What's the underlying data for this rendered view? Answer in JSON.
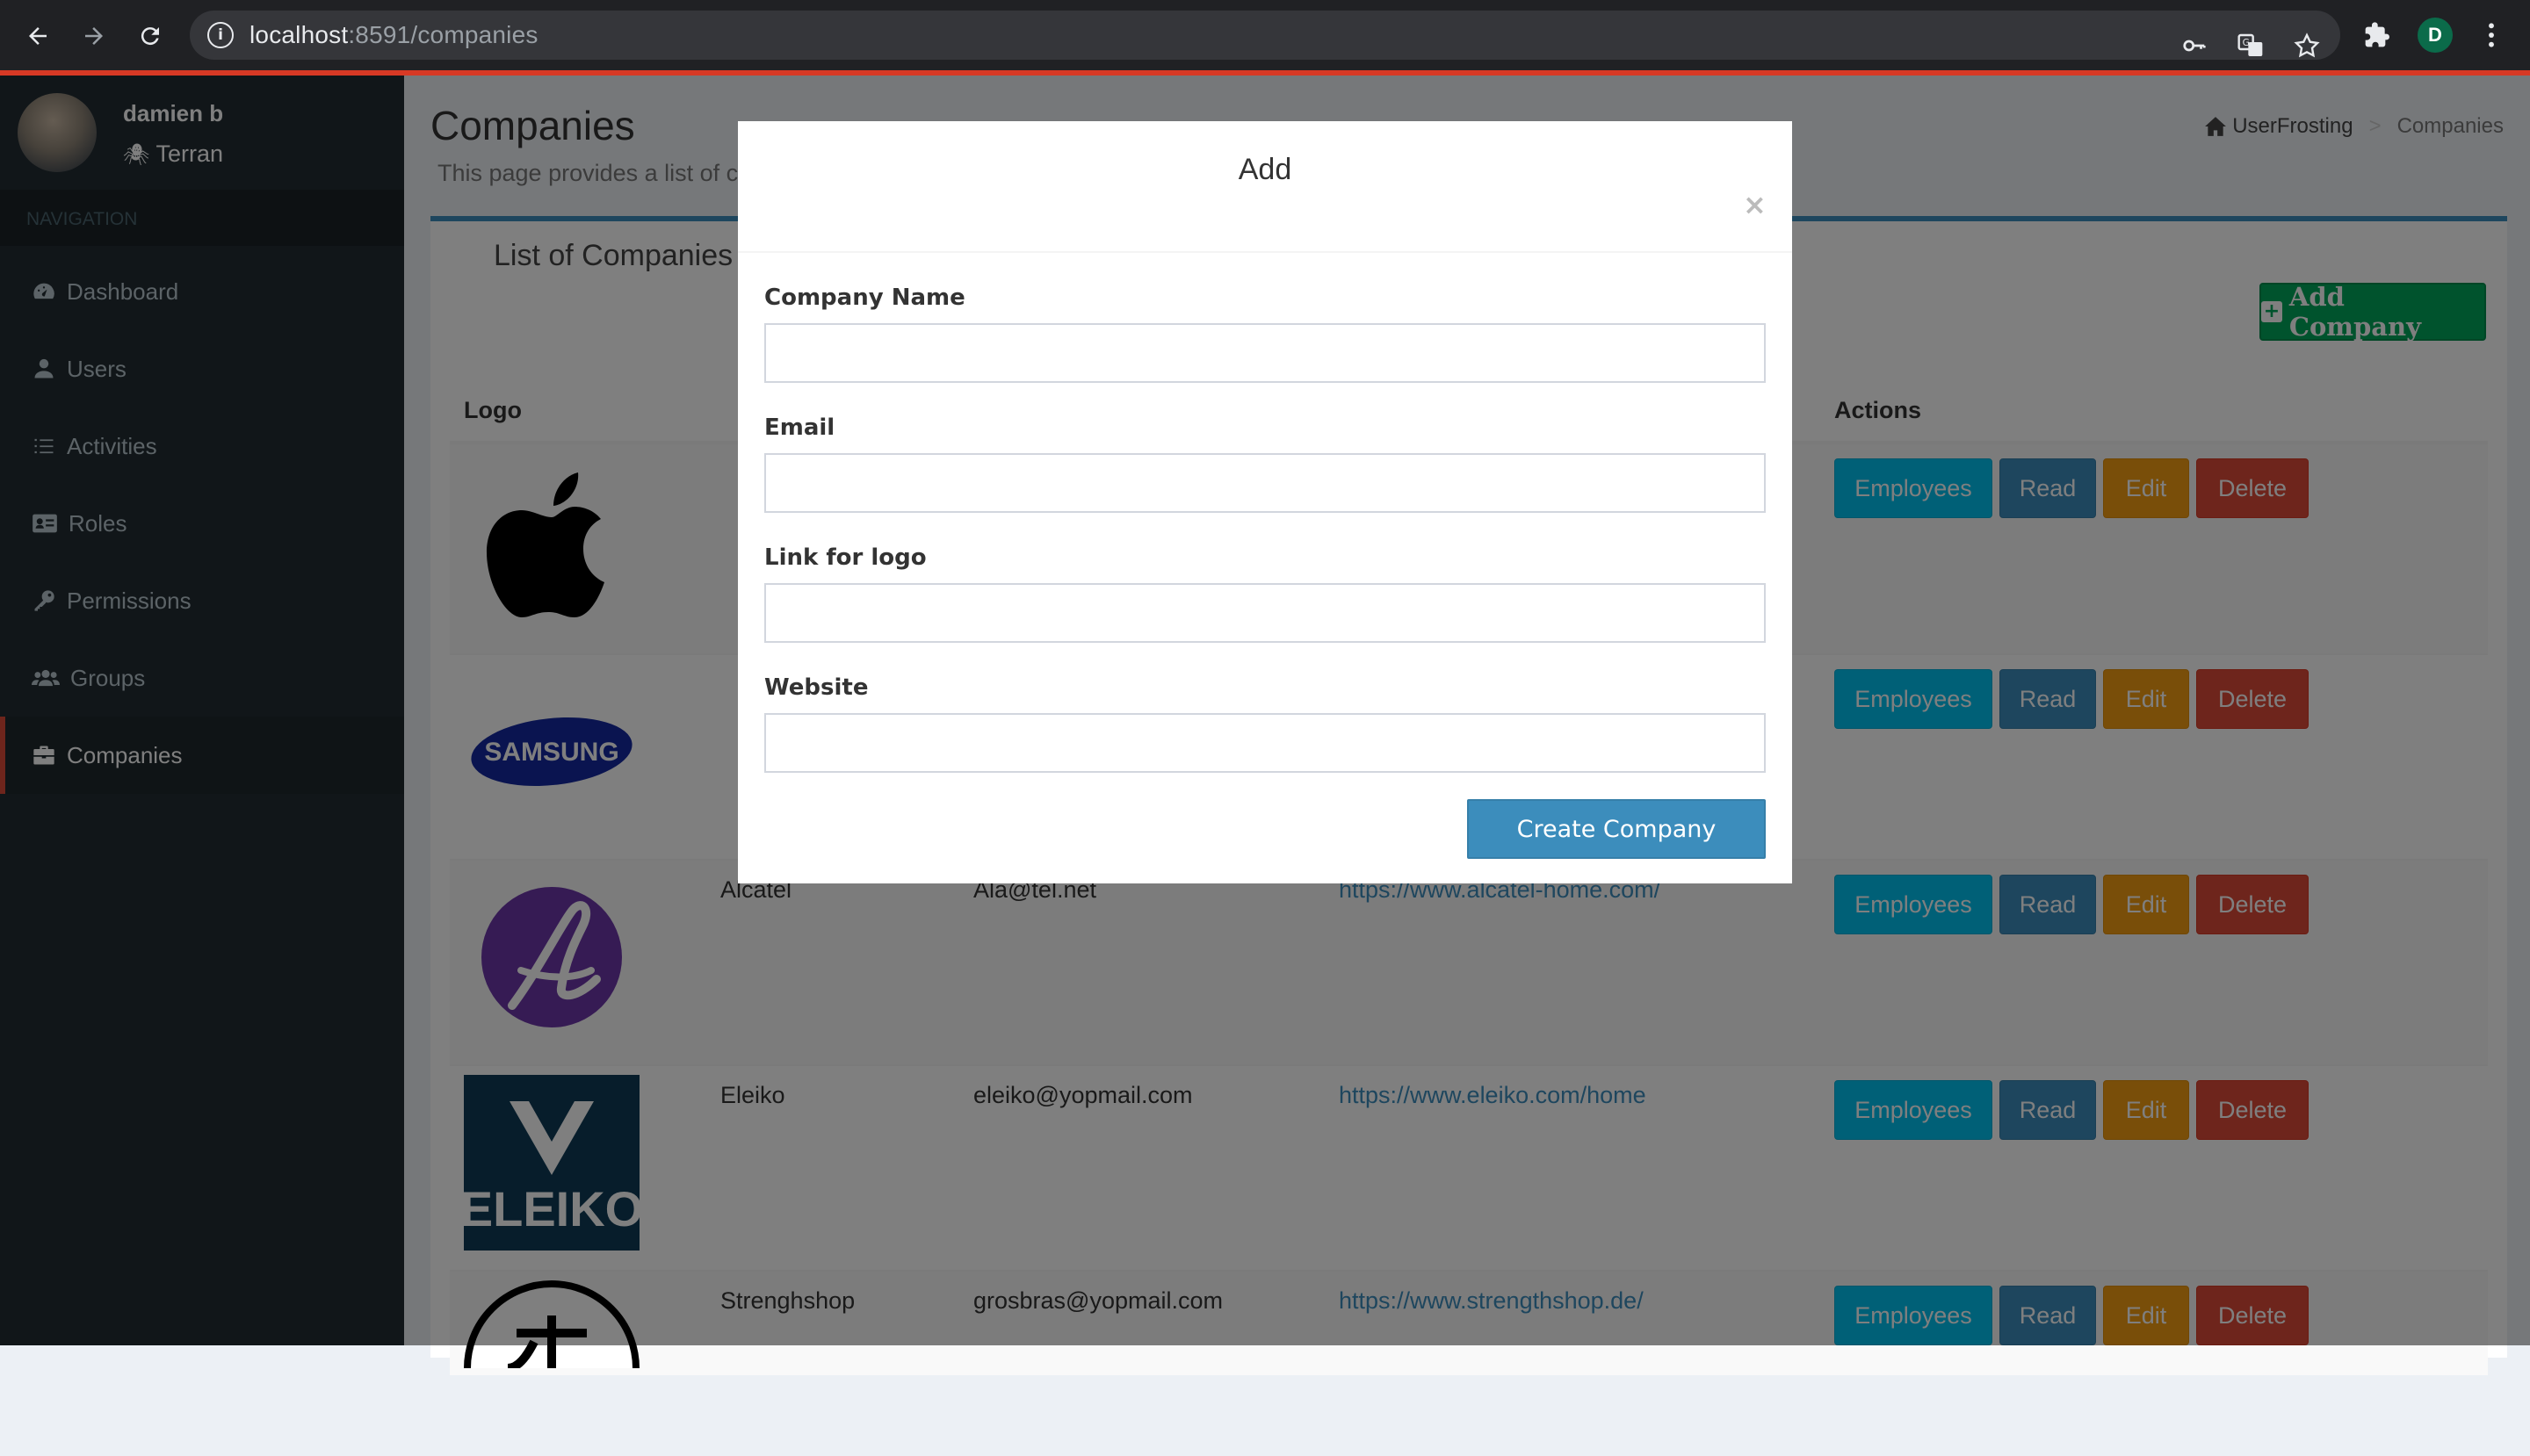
{
  "browser": {
    "url_host": "localhost",
    "url_rest": ":8591/companies",
    "profile_initial": "D"
  },
  "user": {
    "name": "damien b",
    "role": "Terran"
  },
  "nav": {
    "header": "NAVIGATION",
    "items": [
      {
        "label": "Dashboard",
        "icon": "dashboard-icon"
      },
      {
        "label": "Users",
        "icon": "user-icon"
      },
      {
        "label": "Activities",
        "icon": "list-icon"
      },
      {
        "label": "Roles",
        "icon": "id-card-icon"
      },
      {
        "label": "Permissions",
        "icon": "key-icon"
      },
      {
        "label": "Groups",
        "icon": "users-icon"
      },
      {
        "label": "Companies",
        "icon": "briefcase-icon"
      }
    ]
  },
  "page": {
    "title": "Companies",
    "subtitle": "This page provides a list of co",
    "breadcrumb": {
      "home": "UserFrosting",
      "current": "Companies"
    }
  },
  "box": {
    "title": "List of Companies",
    "add_button": "Add Company"
  },
  "table": {
    "headers": {
      "logo": "Logo",
      "actions": "Actions"
    },
    "rows": [
      {
        "logo": "apple-logo",
        "name": "",
        "email": "",
        "website": ""
      },
      {
        "logo": "samsung-logo",
        "name": "",
        "email": "",
        "website": ""
      },
      {
        "logo": "alcatel-logo",
        "name": "Alcatel",
        "email": "Ala@tel.net",
        "website": "https://www.alcatel-home.com/"
      },
      {
        "logo": "eleiko-logo",
        "name": "Eleiko",
        "email": "eleiko@yopmail.com",
        "website": "https://www.eleiko.com/home"
      },
      {
        "logo": "strengthshop-logo",
        "name": "Strenghshop",
        "email": "grosbras@yopmail.com",
        "website": "https://www.strengthshop.de/"
      }
    ],
    "row_actions": {
      "employees": "Employees",
      "read": "Read",
      "edit": "Edit",
      "delete": "Delete"
    }
  },
  "logo_text": {
    "samsung": "SAMSUNG",
    "eleiko": "ELEIKO"
  },
  "modal": {
    "title": "Add",
    "close": "×",
    "fields": [
      {
        "label": "Company Name",
        "value": "",
        "placeholder": ""
      },
      {
        "label": "Email",
        "value": "",
        "placeholder": ""
      },
      {
        "label": "Link for logo",
        "value": "",
        "placeholder": ""
      },
      {
        "label": "Website",
        "value": "",
        "placeholder": ""
      }
    ],
    "submit": "Create Company"
  },
  "colors": {
    "sidebar": "#222d32",
    "primary": "#3c8dbc",
    "success": "#00a65a",
    "info": "#00c0ef",
    "warning": "#f39c12",
    "danger": "#dd4b39"
  }
}
